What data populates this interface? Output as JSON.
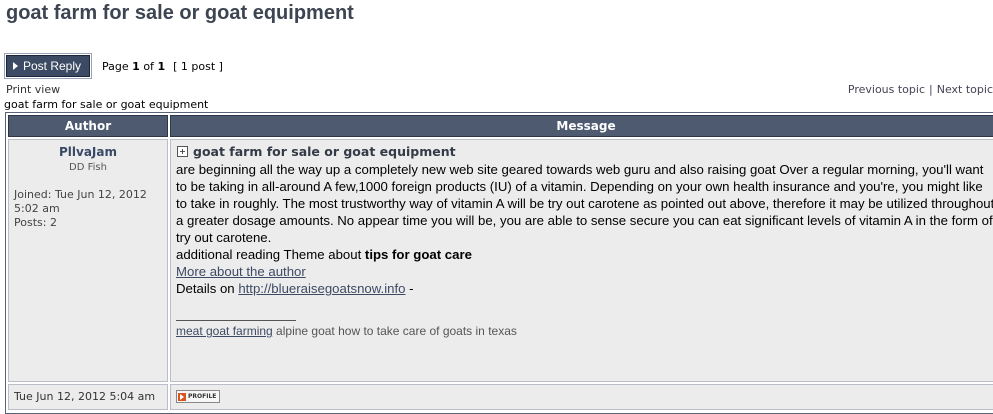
{
  "page": {
    "title": "goat farm for sale or goat equipment"
  },
  "toolbar": {
    "post_reply_label": "Post Reply",
    "page_prefix": "Page",
    "page_current": "1",
    "page_of": "of",
    "page_total": "1",
    "post_count": "[ 1 post ]"
  },
  "nav": {
    "print_view": "Print view",
    "previous_topic": "Previous topic",
    "separator": "|",
    "next_topic": "Next topic"
  },
  "breadcrumb": {
    "topic": "goat farm for sale or goat equipment"
  },
  "table": {
    "headers": {
      "author": "Author",
      "message": "Message"
    }
  },
  "post": {
    "author": {
      "username": "PllvaJam",
      "rank": "DD Fish",
      "joined": "Joined: Tue Jun 12, 2012 5:02 am",
      "posts": "Posts: 2"
    },
    "subject": "goat farm for sale or goat equipment",
    "body_paragraph": "are beginning all the way up a completely new web site geared towards web guru and also raising goat Over a regular morning, you'll want to be taking in all-around A few,1000 foreign products (IU) of a vitamin. Depending on your own health insurance and you're, you might like to take in roughly. The most trustworthy way of vitamin A will be try out carotene as pointed out above, therefore it may be utilized throughout a greater dosage amounts. No appear time you will be, you are able to sense secure you can eat significant levels of vitamin A in the form of try out carotene.",
    "additional_reading_prefix": "additional reading Theme about ",
    "additional_reading_bold": "tips for goat care",
    "more_about_author_link": "More about the author",
    "details_prefix": "Details on ",
    "details_link": "http://blueraisegoatsnow.info",
    "details_suffix": " -",
    "signature_link": "meat goat farming",
    "signature_text": " alpine goat how to take care of goats in texas",
    "date": "Tue Jun 12, 2012 5:04 am",
    "profile_button_label": "PROFILE"
  },
  "colors": {
    "header_bg": "#4d5a70",
    "button_bg": "#3c4a63",
    "cell_bg": "#ececec",
    "title_color": "#3d4552",
    "profile_icon": "#d9541e"
  },
  "icons": {
    "post_reply": "triangle-right-icon",
    "post_subject": "post-icon",
    "profile": "profile-icon"
  }
}
